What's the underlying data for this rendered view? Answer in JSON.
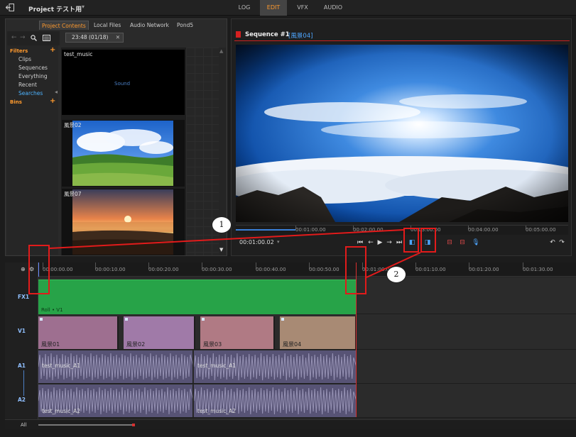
{
  "app": {
    "project_title": "Project テスト用",
    "mode_tabs": [
      "LOG",
      "EDIT",
      "VFX",
      "AUDIO"
    ],
    "active_mode": "EDIT"
  },
  "browser": {
    "tabs": [
      "Project Contents",
      "Local Files",
      "Audio Network",
      "Pond5"
    ],
    "active_tab": "Project Contents",
    "filters_heading": "Filters",
    "filter_items": [
      "Clips",
      "Sequences",
      "Everything",
      "Recent",
      "Searches"
    ],
    "selected_filter": "Searches",
    "bins_heading": "Bins",
    "bin_tab_label": "23:48 (01/18)",
    "clips": [
      {
        "name": "test_music",
        "kind_label": "Sound"
      },
      {
        "name": "風景02"
      },
      {
        "name": "風景07"
      }
    ]
  },
  "viewer": {
    "sequence_name": "Sequence #1",
    "clip_name": "[風景04]",
    "timecode": "00:01:00.02",
    "ruler_labels": [
      "00:01:00.00",
      "00:02:00.00",
      "00:03:00.00",
      "00:04:00.00",
      "00:05:00.00"
    ],
    "progress_fraction": 0.18
  },
  "timeline": {
    "ruler_labels": [
      "00:00:00.00",
      "00:00:10.00",
      "00:00:20.00",
      "00:00:30.00",
      "00:00:40.00",
      "00:00:50.00",
      "00:01:00.00",
      "00:01:10.00",
      "00:01:20.00",
      "00:01:30.00"
    ],
    "tracks": [
      "FX1",
      "V1",
      "A1",
      "A2"
    ],
    "fx_clip_name": "Roll • V1",
    "video_clips": [
      "風景01",
      "風景02",
      "風景03",
      "風景04"
    ],
    "audio_clips": [
      {
        "track": "A1",
        "names": [
          "test_music_A1",
          "test_music_A1"
        ]
      },
      {
        "track": "A2",
        "names": [
          "test_music_A2",
          "test_music_A2"
        ]
      }
    ],
    "all_label": "All"
  },
  "annotations": {
    "callouts": [
      "1",
      "2"
    ]
  },
  "colors": {
    "accent": "#ff9a2e",
    "selection": "#4db3ff",
    "fx_clip": "#27a348",
    "video_clip": "#9e6f90",
    "audio_clip": "#575375",
    "annotation": "#e21b1b"
  }
}
